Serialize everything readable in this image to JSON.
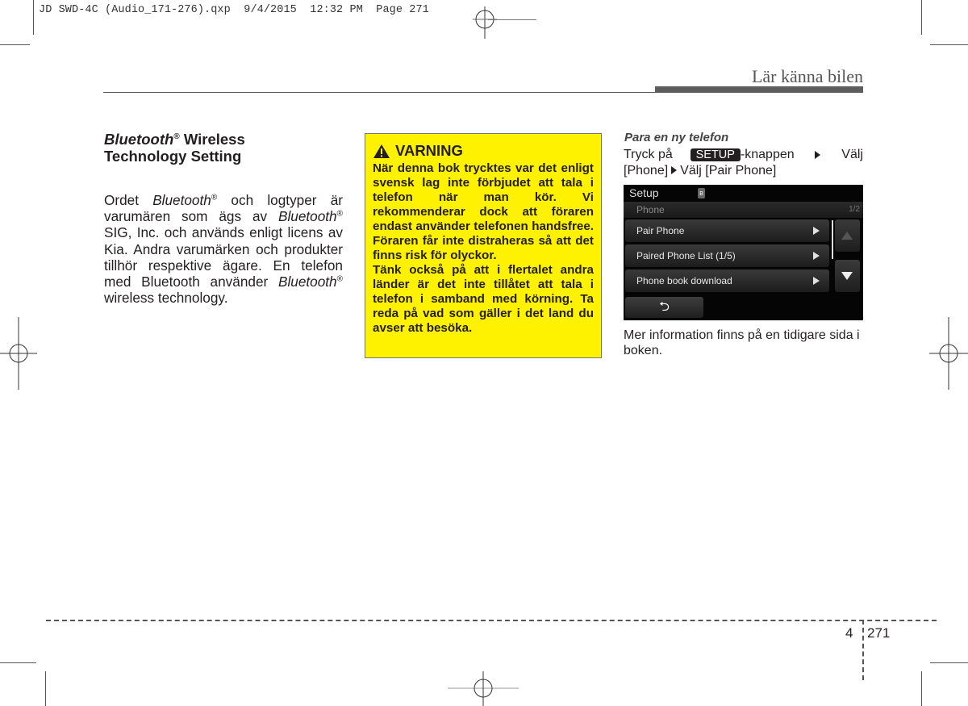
{
  "slug": "JD SWD-4C (Audio_171-276).qxp  9/4/2015  12:32 PM  Page 271",
  "header": {
    "section_title": "Lär känna bilen"
  },
  "left_column": {
    "heading_italic": "Bluetooth",
    "heading_reg": "®",
    "heading_rest_line1": " Wireless",
    "heading_line2": "Technology Setting",
    "para": {
      "p1": "Ordet ",
      "bt1": "Bluetooth",
      "reg": "®",
      "p2": " och logtyper är varumären som ägs av ",
      "bt2": "Bluetooth",
      "p3": " SIG, Inc. och används enligt licens av Kia. Andra varumärken och produkter tillhör respektive ägare. En telefon med Bluetooth använder ",
      "bt3": "Bluetooth",
      "p4": " wireless technology."
    }
  },
  "warning": {
    "icon": "warning-triangle-icon",
    "title": "VARNING",
    "para1": "När denna bok trycktes var det enligt svensk lag inte förbjudet att tala i telefon när man kör. Vi rekommenderar dock att föraren endast använder telefonen handsfree. Föraren får inte distraheras så att det finns risk för olyckor.",
    "para2": "Tänk också på att i flertalet andra länder är det inte tillåtet att tala i telefon i samband med körning. Ta reda på vad som gäller i det land du avser att besöka."
  },
  "right_column": {
    "subheading": "Para en ny telefon",
    "instr_prefix": "Tryck på",
    "setup_key": "SETUP",
    "instr_knappen": "-knappen",
    "instr_valj1": "Välj",
    "instr_phone": "[Phone]",
    "instr_valj2": "Välj [Pair Phone]",
    "after_text": "Mer information finns på en tidigare sida i boken."
  },
  "screen": {
    "title": "Setup",
    "bt_icon": "bluetooth-icon",
    "subtitle": "Phone",
    "page_indicator": "1/2",
    "items": [
      {
        "label": "Pair Phone"
      },
      {
        "label": "Paired Phone List  (1/5)"
      },
      {
        "label": "Phone book download"
      }
    ],
    "back_glyph": "⮌"
  },
  "footer": {
    "chapter": "4",
    "page": "271"
  }
}
